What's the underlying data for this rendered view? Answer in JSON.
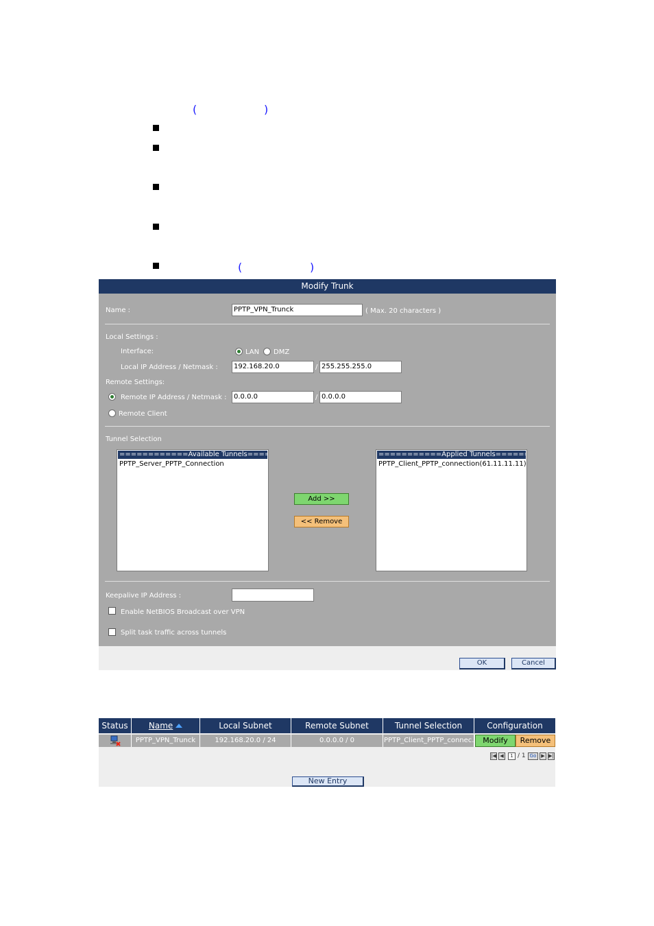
{
  "doc": {
    "paren1_open": "(",
    "paren1_close": ")",
    "paren2_open": "(",
    "paren2_close": ")"
  },
  "form": {
    "title": "Modify Trunk",
    "name_label": "Name :",
    "name_value": "PPTP_VPN_Trunck",
    "name_hint": "( Max. 20 characters )",
    "local_settings_label": "Local Settings :",
    "interface_label": "Interface:",
    "interface_options": [
      "LAN",
      "DMZ"
    ],
    "interface_selected": "LAN",
    "local_ip_label": "Local IP Address / Netmask :",
    "local_ip_value": "192.168.20.0",
    "local_netmask_value": "255.255.255.0",
    "slash": "/",
    "remote_settings_label": "Remote Settings:",
    "remote_ip_label": "Remote IP Address / Netmask :",
    "remote_ip_value": "0.0.0.0",
    "remote_netmask_value": "0.0.0.0",
    "remote_client_label": "Remote Client",
    "tunnel_selection_label": "Tunnel Selection",
    "available_header": "============Available Tunnels============",
    "available_items": [
      "PPTP_Server_PPTP_Connection"
    ],
    "applied_header": "===========Applied Tunnels=============",
    "applied_items": [
      "PPTP_Client_PPTP_connection(61.11.11.11)"
    ],
    "add_button": "Add >>",
    "remove_button": "<< Remove",
    "keepalive_label": "Keepalive IP Address :",
    "keepalive_value": "",
    "netbios_label": "Enable NetBIOS Broadcast over VPN",
    "netbios_checked": false,
    "split_label": "Split task traffic across tunnels",
    "split_checked": false,
    "ok_button": "OK",
    "cancel_button": "Cancel"
  },
  "table": {
    "columns": [
      "Status",
      "Name",
      "Local Subnet",
      "Remote Subnet",
      "Tunnel Selection",
      "Configuration"
    ],
    "sort_column": "Name",
    "rows": [
      {
        "status_icon": "disconnected-computer-icon",
        "name": "PPTP_VPN_Trunck",
        "local_subnet": "192.168.20.0 / 24",
        "remote_subnet": "0.0.0.0 / 0",
        "tunnel_selection": "PPTP_Client_PPTP_connec...",
        "modify_label": "Modify",
        "remove_label": "Remove"
      }
    ],
    "pager": {
      "current_page": "1",
      "total": "/ 1",
      "go_label": "Go"
    },
    "new_entry_button": "New Entry"
  },
  "colors": {
    "header_bg": "#1f3864",
    "panel_bg": "#a9a9a9",
    "add_green": "#7ed66f",
    "remove_orange": "#f4c07a"
  }
}
